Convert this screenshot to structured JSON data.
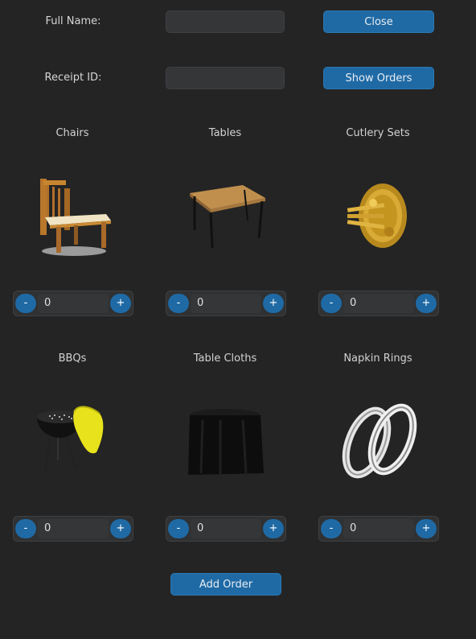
{
  "form": {
    "full_name_label": "Full Name:",
    "full_name_value": "",
    "receipt_id_label": "Receipt ID:",
    "receipt_id_value": ""
  },
  "buttons": {
    "close": "Close",
    "show_orders": "Show Orders",
    "add_order": "Add Order"
  },
  "items": [
    {
      "title": "Chairs",
      "minus": "-",
      "plus": "+",
      "quantity": "0",
      "icon": "chair-image"
    },
    {
      "title": "Tables",
      "minus": "-",
      "plus": "+",
      "quantity": "0",
      "icon": "table-image"
    },
    {
      "title": "Cutlery Sets",
      "minus": "-",
      "plus": "+",
      "quantity": "0",
      "icon": "cutlery-image"
    },
    {
      "title": "BBQs",
      "minus": "-",
      "plus": "+",
      "quantity": "0",
      "icon": "bbq-image"
    },
    {
      "title": "Table Cloths",
      "minus": "-",
      "plus": "+",
      "quantity": "0",
      "icon": "tablecloth-image"
    },
    {
      "title": "Napkin Rings",
      "minus": "-",
      "plus": "+",
      "quantity": "0",
      "icon": "napkin-rings-image"
    }
  ],
  "colors": {
    "background": "#242424",
    "accent": "#1f6aa5",
    "field": "#343638"
  }
}
